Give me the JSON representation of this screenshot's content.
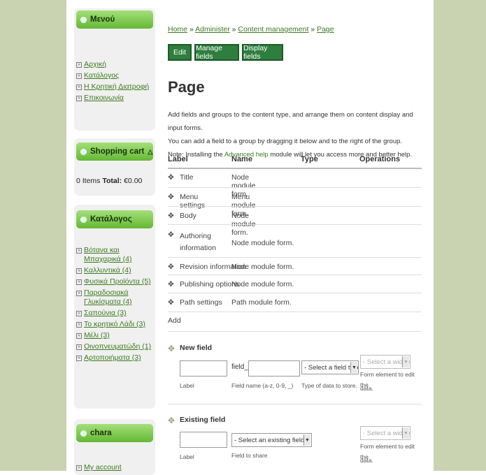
{
  "sidebar": {
    "menu": {
      "title": "Μενού",
      "items": [
        "Αρχική",
        "Κατάλογος",
        "Η Κρητική Διατροφή",
        "Επικοινωνία"
      ]
    },
    "cart": {
      "title": "Shopping cart",
      "items_label": "0 Items",
      "total_label": "Total:",
      "total_value": "€0.00"
    },
    "catalog": {
      "title": "Κατάλογος",
      "items": [
        "Βότανα και Μπαχαρικά (4)",
        "Καλλυντικά (4)",
        "Φυσικά Προϊόντα (5)",
        "Παραδοσιακά Γλυκίσματα (4)",
        "Σαπούνια (3)",
        "Το κρητικό Λάδι (3)",
        "Μέλι (3)",
        "Οινοπνευματώδη (1)",
        "Αρτοποιήματα (3)"
      ]
    },
    "user": {
      "title": "chara",
      "items": [
        "My account"
      ]
    }
  },
  "breadcrumb": [
    "Home",
    "Administer",
    "Content management",
    "Page"
  ],
  "breadcrumb_sep": "»",
  "tabs": [
    "Edit",
    "Manage fields",
    "Display fields"
  ],
  "page_title": "Page",
  "intro": [
    "Add fields and groups to the content type, and arrange them on content display and input forms.",
    "You can add a field to a group by dragging it below and to the right of the group."
  ],
  "note_prefix": "Note: Installing the",
  "note_link": "Advanced help",
  "note_suffix": "module will let you access more and better help.",
  "table": {
    "headers": [
      "Label",
      "Name",
      "Type",
      "Operations"
    ],
    "rows": [
      {
        "label": "Title",
        "name": "Node module form."
      },
      {
        "label": "Menu settings",
        "name": "Menu module form."
      },
      {
        "label": "Body",
        "name": "Node module form."
      },
      {
        "label": "Authoring information",
        "name": "Node module form."
      },
      {
        "label": "Revision information",
        "name": "Node module form."
      },
      {
        "label": "Publishing options",
        "name": "Node module form."
      },
      {
        "label": "Path settings",
        "name": "Path module form."
      }
    ],
    "add_label": "Add"
  },
  "new_field": {
    "title": "New field",
    "label_caption": "Label",
    "field_prefix": "field_",
    "field_caption": "Field name (a-z, 0-9, _)",
    "type_placeholder": "- Select a field type -",
    "type_caption": "Type of data to store.",
    "widget_placeholder": "- Select a widget -",
    "widget_caption_1": "Form element to edit the",
    "widget_caption_2": "data."
  },
  "existing_field": {
    "title": "Existing field",
    "label_caption": "Label",
    "field_placeholder": "- Select an existing field -",
    "field_caption": "Field to share",
    "widget_placeholder": "- Select a widget -",
    "widget_caption_1": "Form element to edit the",
    "widget_caption_2": "data."
  },
  "colors": {
    "band": "#c9d3b1",
    "block_head": "#64b834",
    "tab_button": "#2e7e3e",
    "link": "#3d7a1f"
  }
}
